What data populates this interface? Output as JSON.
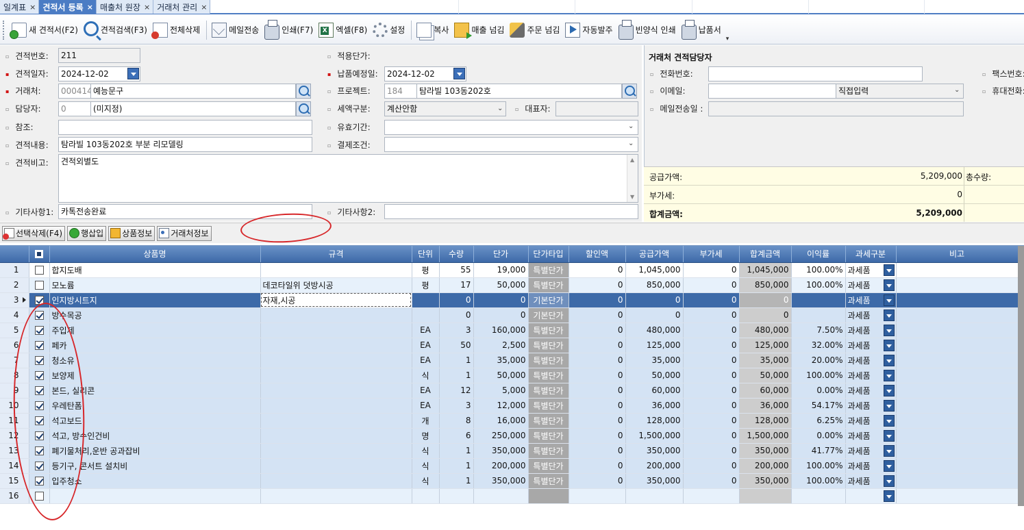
{
  "tabs": [
    {
      "label": "일계표",
      "active": false
    },
    {
      "label": "견적서 등록",
      "active": true
    },
    {
      "label": "매출처 원장",
      "active": false
    },
    {
      "label": "거래처 관리",
      "active": false
    }
  ],
  "toolbar": {
    "new": "새 견적서(F2)",
    "search": "견적검색(F3)",
    "delete_all": "전체삭제",
    "mail": "메일전송",
    "print": "인쇄(F7)",
    "excel": "엑셀(F8)",
    "settings": "설정",
    "copy": "복사",
    "sales_transfer": "매출 넘김",
    "order_transfer": "주문 넘김",
    "auto_order": "자동발주",
    "blank_print": "빈양식 인쇄",
    "delivery": "납품서"
  },
  "form": {
    "quote_no_label": "견적번호:",
    "quote_no": "211",
    "quote_date_label": "견적일자:",
    "quote_date": "2024-12-02",
    "client_label": "거래처:",
    "client_code": "000414",
    "client_name": "예능문구",
    "manager_label": "담당자:",
    "manager_code": "0",
    "manager_name": "(미지정)",
    "ref_label": "참조:",
    "ref": "",
    "content_label": "견적내용:",
    "content": "탐라빌 103동202호 부분 리모델링",
    "note_label": "견적비고:",
    "note": "견적외별도",
    "etc1_label": "기타사항1:",
    "etc1": "카톡전송완료",
    "price_label": "적용단가:",
    "delivery_date_label": "납품예정일:",
    "delivery_date": "2024-12-02",
    "project_label": "프로젝트:",
    "project_code": "184",
    "project_name": "탐라빌 103동202호",
    "tax_label": "세액구분:",
    "tax": "계산안함",
    "rep_label": "대표자:",
    "rep": "",
    "valid_label": "유효기간:",
    "valid": "",
    "pay_label": "결제조건:",
    "pay": "",
    "etc2_label": "기타사항2:",
    "etc2": ""
  },
  "contact": {
    "title": "거래처 견적담당자",
    "phone_label": "전화번호:",
    "phone": "",
    "fax_label": "팩스번호:",
    "email_label": "이메일:",
    "email": "",
    "email_domain": "직접입력",
    "mobile_label": "휴대전화:",
    "mail_date_label": "메일전송일 :",
    "mail_date": ""
  },
  "summary": {
    "supply_label": "공급가액:",
    "supply": "5,209,000",
    "qty_label": "총수량:",
    "vat_label": "부가세:",
    "vat": "0",
    "total_label": "합계금액:",
    "total": "5,209,000"
  },
  "grid_toolbar": {
    "del_selected": "선택삭제(F4)",
    "insert_row": "행삽입",
    "product_info": "상품정보",
    "client_info": "거래처정보"
  },
  "columns": [
    "상품명",
    "규격",
    "단위",
    "수량",
    "단가",
    "단가타입",
    "할인액",
    "공급가액",
    "부가세",
    "합계금액",
    "이익률",
    "과세구분",
    "비고"
  ],
  "rows": [
    {
      "no": "1",
      "checked": false,
      "name": "합지도배",
      "spec": "",
      "unit": "평",
      "qty": "55",
      "price": "19,000",
      "ptype": "특별단가",
      "disc": "0",
      "supply": "1,045,000",
      "vat": "0",
      "total": "1,045,000",
      "margin": "100.00%",
      "tax": "과세품",
      "memo": ""
    },
    {
      "no": "2",
      "checked": false,
      "name": "모노륨",
      "spec": "데코타일위 덧방시공",
      "unit": "평",
      "qty": "17",
      "price": "50,000",
      "ptype": "특별단가",
      "disc": "0",
      "supply": "850,000",
      "vat": "0",
      "total": "850,000",
      "margin": "100.00%",
      "tax": "과세품",
      "memo": ""
    },
    {
      "no": "3",
      "checked": true,
      "name": "인지방시트지",
      "spec": "자재,시공",
      "unit": "",
      "qty": "0",
      "price": "0",
      "ptype": "기본단가",
      "disc": "0",
      "supply": "0",
      "vat": "0",
      "total": "0",
      "margin": "",
      "tax": "과세품",
      "memo": ""
    },
    {
      "no": "4",
      "checked": true,
      "name": "방수목공",
      "spec": "",
      "unit": "",
      "qty": "0",
      "price": "0",
      "ptype": "기본단가",
      "disc": "0",
      "supply": "0",
      "vat": "0",
      "total": "0",
      "margin": "",
      "tax": "과세품",
      "memo": ""
    },
    {
      "no": "5",
      "checked": true,
      "name": "주입제",
      "spec": "",
      "unit": "EA",
      "qty": "3",
      "price": "160,000",
      "ptype": "특별단가",
      "disc": "0",
      "supply": "480,000",
      "vat": "0",
      "total": "480,000",
      "margin": "7.50%",
      "tax": "과세품",
      "memo": ""
    },
    {
      "no": "6",
      "checked": true,
      "name": "페카",
      "spec": "",
      "unit": "EA",
      "qty": "50",
      "price": "2,500",
      "ptype": "특별단가",
      "disc": "0",
      "supply": "125,000",
      "vat": "0",
      "total": "125,000",
      "margin": "32.00%",
      "tax": "과세품",
      "memo": ""
    },
    {
      "no": "7",
      "checked": true,
      "name": "청소유",
      "spec": "",
      "unit": "EA",
      "qty": "1",
      "price": "35,000",
      "ptype": "특별단가",
      "disc": "0",
      "supply": "35,000",
      "vat": "0",
      "total": "35,000",
      "margin": "20.00%",
      "tax": "과세품",
      "memo": ""
    },
    {
      "no": "8",
      "checked": true,
      "name": "보양제",
      "spec": "",
      "unit": "식",
      "qty": "1",
      "price": "50,000",
      "ptype": "특별단가",
      "disc": "0",
      "supply": "50,000",
      "vat": "0",
      "total": "50,000",
      "margin": "100.00%",
      "tax": "과세품",
      "memo": ""
    },
    {
      "no": "9",
      "checked": true,
      "name": "본드, 실리콘",
      "spec": "",
      "unit": "EA",
      "qty": "12",
      "price": "5,000",
      "ptype": "특별단가",
      "disc": "0",
      "supply": "60,000",
      "vat": "0",
      "total": "60,000",
      "margin": "0.00%",
      "tax": "과세품",
      "memo": ""
    },
    {
      "no": "10",
      "checked": true,
      "name": "우레탄폼",
      "spec": "",
      "unit": "EA",
      "qty": "3",
      "price": "12,000",
      "ptype": "특별단가",
      "disc": "0",
      "supply": "36,000",
      "vat": "0",
      "total": "36,000",
      "margin": "54.17%",
      "tax": "과세품",
      "memo": ""
    },
    {
      "no": "11",
      "checked": true,
      "name": "석고보드",
      "spec": "",
      "unit": "개",
      "qty": "8",
      "price": "16,000",
      "ptype": "특별단가",
      "disc": "0",
      "supply": "128,000",
      "vat": "0",
      "total": "128,000",
      "margin": "6.25%",
      "tax": "과세품",
      "memo": ""
    },
    {
      "no": "12",
      "checked": true,
      "name": "석고, 방수인건비",
      "spec": "",
      "unit": "명",
      "qty": "6",
      "price": "250,000",
      "ptype": "특별단가",
      "disc": "0",
      "supply": "1,500,000",
      "vat": "0",
      "total": "1,500,000",
      "margin": "0.00%",
      "tax": "과세품",
      "memo": ""
    },
    {
      "no": "13",
      "checked": true,
      "name": "폐기물처리,운반 공과잡비",
      "spec": "",
      "unit": "식",
      "qty": "1",
      "price": "350,000",
      "ptype": "특별단가",
      "disc": "0",
      "supply": "350,000",
      "vat": "0",
      "total": "350,000",
      "margin": "41.77%",
      "tax": "과세품",
      "memo": ""
    },
    {
      "no": "14",
      "checked": true,
      "name": "등기구, 콘서트 설치비",
      "spec": "",
      "unit": "식",
      "qty": "1",
      "price": "200,000",
      "ptype": "특별단가",
      "disc": "0",
      "supply": "200,000",
      "vat": "0",
      "total": "200,000",
      "margin": "100.00%",
      "tax": "과세품",
      "memo": ""
    },
    {
      "no": "15",
      "checked": true,
      "name": "입주청소",
      "spec": "",
      "unit": "식",
      "qty": "1",
      "price": "350,000",
      "ptype": "특별단가",
      "disc": "0",
      "supply": "350,000",
      "vat": "0",
      "total": "350,000",
      "margin": "100.00%",
      "tax": "과세품",
      "memo": ""
    },
    {
      "no": "16",
      "checked": false,
      "name": "",
      "spec": "",
      "unit": "",
      "qty": "",
      "price": "",
      "ptype": "",
      "disc": "",
      "supply": "",
      "vat": "",
      "total": "",
      "margin": "",
      "tax": "",
      "memo": ""
    }
  ]
}
